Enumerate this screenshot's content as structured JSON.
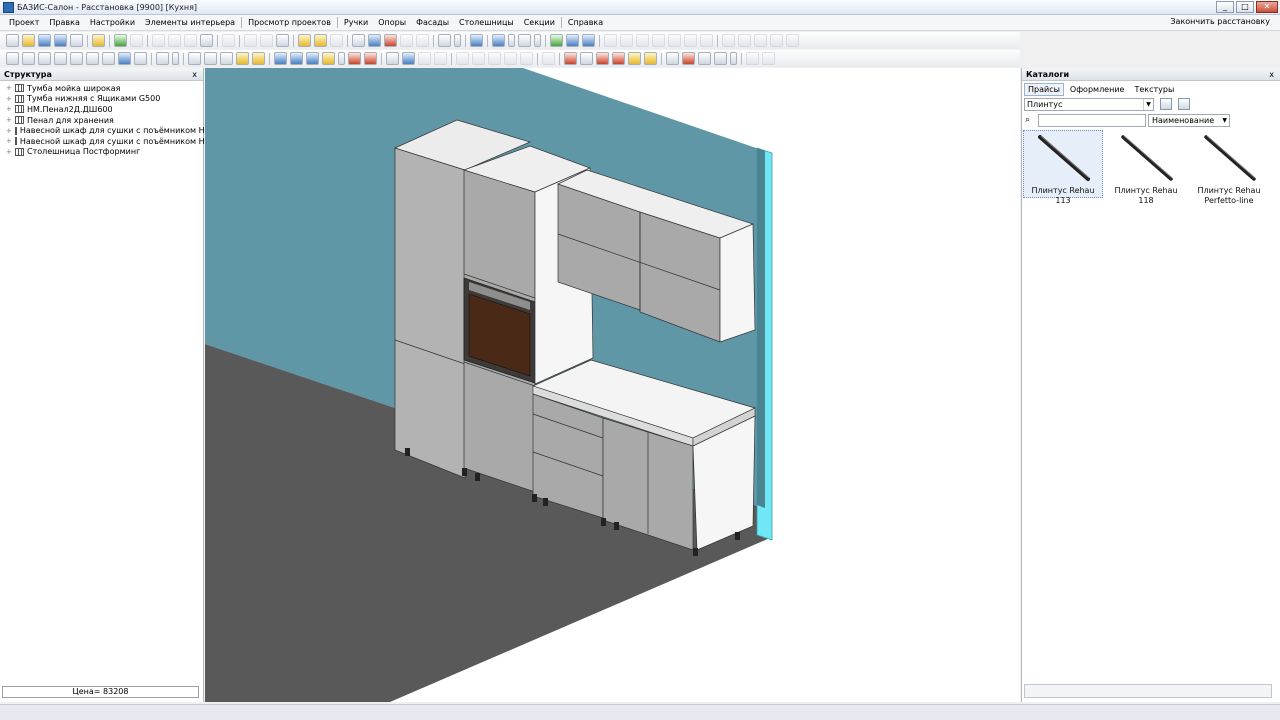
{
  "window": {
    "title": "БАЗИС-Салон - Расстановка [9900] [Кухня]",
    "controls": [
      "_",
      "□",
      "✕"
    ]
  },
  "menu": {
    "items": [
      "Проект",
      "Правка",
      "Настройки",
      "Элементы интерьера",
      "Просмотр проектов",
      "Ручки",
      "Опоры",
      "Фасады",
      "Столешницы",
      "Секции",
      "Справка"
    ],
    "finish_label": "Закончить расстановку"
  },
  "structure": {
    "title": "Структура",
    "close": "x",
    "items": [
      "Тумба мойка широкая",
      "Тумба нижняя с Ящиками G500",
      "НМ.Пенал2Д.ДШ600",
      "Пенал для хранения",
      "Навесной шкаф для сушки с поъёмником HF",
      "Навесной шкаф для сушки с поъёмником HF",
      "Столешница Постформинг"
    ],
    "price": "Цена= 83208"
  },
  "catalogs": {
    "title": "Каталоги",
    "close": "x",
    "tabs": [
      "Прайсы",
      "Оформление",
      "Текстуры"
    ],
    "active_tab": "Прайсы",
    "category": "Плинтус",
    "search_value": "",
    "sort_by": "Наименование",
    "items": [
      {
        "label": "Плинтус Rehau 113",
        "selected": true
      },
      {
        "label": "Плинтус Rehau 118",
        "selected": false
      },
      {
        "label": "Плинтус Rehau Perfetto-line",
        "selected": false
      }
    ]
  },
  "colors": {
    "wall": "#5f97a6",
    "floor": "#5a5a5a",
    "cabinet": "#a9a9a9",
    "worktop": "#f4f4f4",
    "glass_edge": "#6fe7f5"
  }
}
